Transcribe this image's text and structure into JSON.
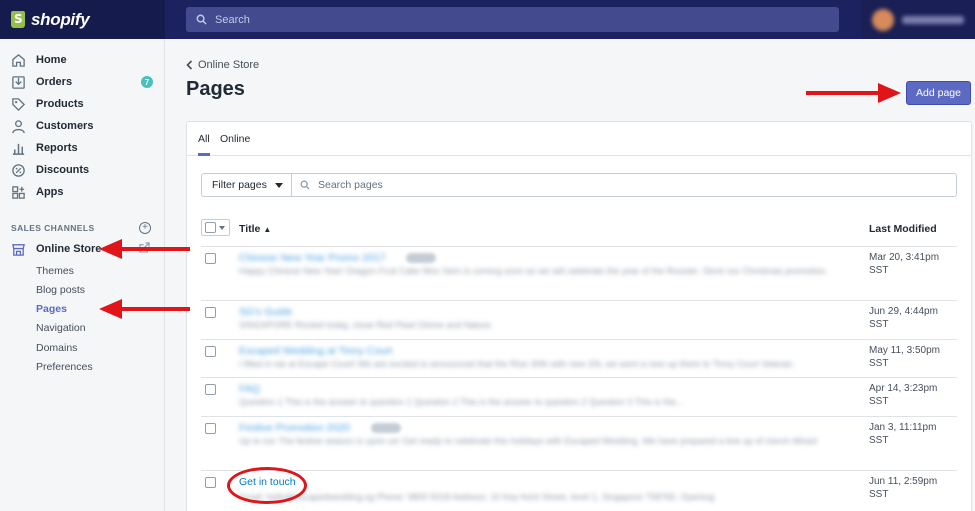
{
  "topbar": {
    "brand": "shopify",
    "search_placeholder": "Search"
  },
  "sidebar": {
    "items": [
      {
        "label": "Home",
        "icon": "home-icon"
      },
      {
        "label": "Orders",
        "icon": "orders-icon",
        "badge": "7"
      },
      {
        "label": "Products",
        "icon": "tag-icon"
      },
      {
        "label": "Customers",
        "icon": "person-icon"
      },
      {
        "label": "Reports",
        "icon": "bar-chart-icon"
      },
      {
        "label": "Discounts",
        "icon": "discount-icon"
      },
      {
        "label": "Apps",
        "icon": "apps-icon"
      }
    ],
    "sales_channels_label": "SALES CHANNELS",
    "online_store": "Online Store",
    "sub_items": [
      "Themes",
      "Blog posts",
      "Pages",
      "Navigation",
      "Domains",
      "Preferences"
    ],
    "active_sub_item": "Pages"
  },
  "main": {
    "breadcrumb": "Online Store",
    "title": "Pages",
    "add_button": "Add page",
    "tabs": [
      "All",
      "Online"
    ],
    "filter_button": "Filter pages",
    "filter_placeholder": "Search pages",
    "columns": {
      "title": "Title",
      "modified": "Last Modified"
    },
    "rows": [
      {
        "title": "Chinese New Year Promo 2017",
        "desc": "Happy Chinese New Year! Dragon Fruit Cake Mon Sem is coming soon as we will celebrate the year of the Rooster. Store our Christmas promotion.",
        "date": "Mar 20, 3:41pm",
        "tz": "SST",
        "blurred": true,
        "tag": true
      },
      {
        "title": "SG's Guide",
        "desc": "SINGAPORE Rooted today, close Red Pearl Divine and Nature",
        "date": "Jun 29, 4:44pm",
        "tz": "SST",
        "blurred": true,
        "tag": false
      },
      {
        "title": "Escaped Wedding at Tinny Court",
        "desc": "I filled in we at Escape Court! We are excited to announced that the Rise 30th with new 20L we went a new up there to Tinny Court Veteran.",
        "date": "May 11, 3:50pm",
        "tz": "SST",
        "blurred": true,
        "tag": false
      },
      {
        "title": "FAQ",
        "desc": "Question 1 This is the answer to question 1 Question 2 This is the answer to question 2 Question 3 This is the...",
        "date": "Apr 14, 3:23pm",
        "tz": "SST",
        "blurred": true,
        "tag": false
      },
      {
        "title": "Festive Promotion 2020",
        "desc": "Up to our The festive season is upon us! Get ready to celebrate this holidays with Escaped Wedding. We have prepared a line up of merch Mixed",
        "date": "Jan 3, 11:11pm",
        "tz": "SST",
        "blurred": true,
        "tag": true
      },
      {
        "title": "Get in touch",
        "desc": "Email: hello@escapedwedding.sg Phone: 9800 5018 Address: 10 Key Kent Street, level 1, Singapore 758765. Opening",
        "date": "Jun 11, 2:59pm",
        "tz": "SST",
        "blurred": false,
        "tag": false
      }
    ]
  },
  "colors": {
    "topbar": "#1c2260",
    "accent": "#5c6ac4",
    "link": "#007ace",
    "annotation_red": "#e0151a"
  }
}
